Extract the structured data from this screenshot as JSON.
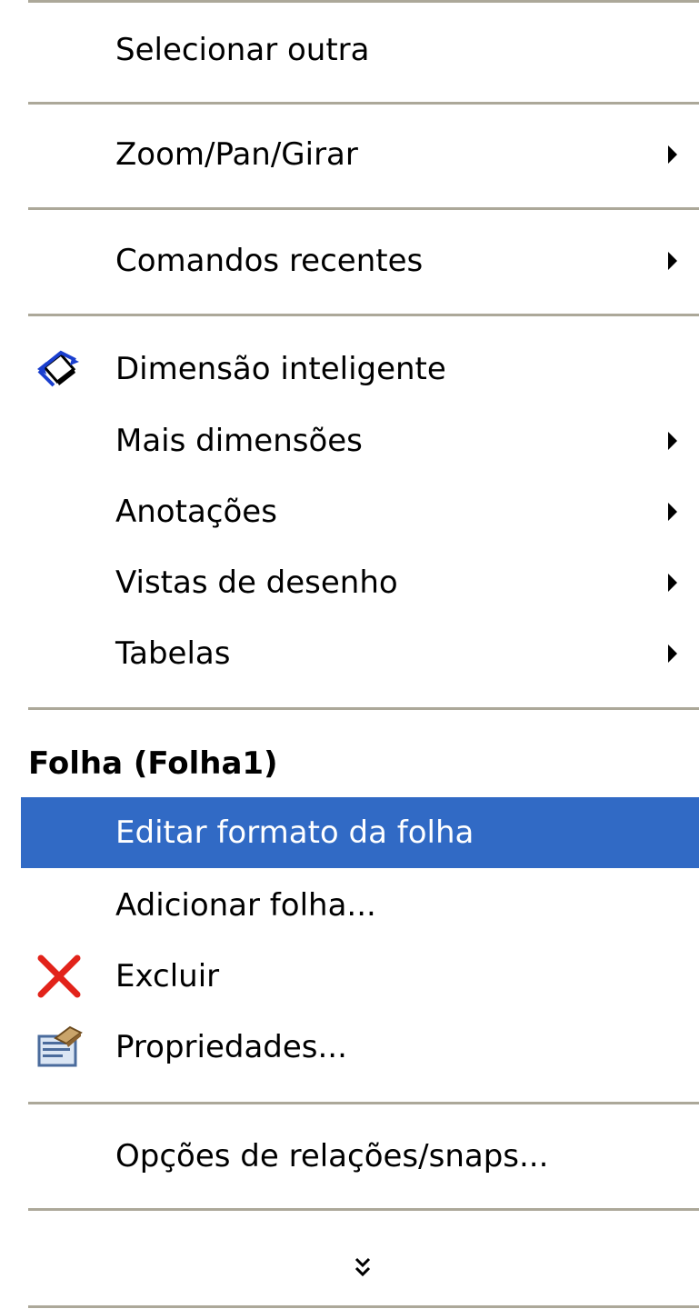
{
  "menu": {
    "items": {
      "select_other": "Selecionar outra",
      "zoom_pan_rotate": "Zoom/Pan/Girar",
      "recent_commands": "Comandos recentes",
      "smart_dimension": "Dimensão inteligente",
      "more_dimensions": "Mais dimensões",
      "annotations": "Anotações",
      "drawing_views": "Vistas de desenho",
      "tables": "Tabelas",
      "edit_sheet_format": "Editar formato da folha",
      "add_sheet": "Adicionar folha...",
      "delete": "Excluir",
      "properties": "Propriedades...",
      "relations_snaps_options": "Opções de relações/snaps..."
    },
    "section_header": "Folha (Folha1)",
    "icons": {
      "smart_dimension": "smart-dimension-icon",
      "delete": "delete-x-icon",
      "properties": "properties-icon",
      "submenu": "submenu-arrow-icon",
      "expand": "expand-chevron-icon"
    },
    "colors": {
      "highlight": "#316ac5",
      "separator": "#aca899",
      "delete_icon": "#e2231a",
      "dimension_icon": "#1a3fcf"
    },
    "highlighted_item": "edit_sheet_format"
  }
}
